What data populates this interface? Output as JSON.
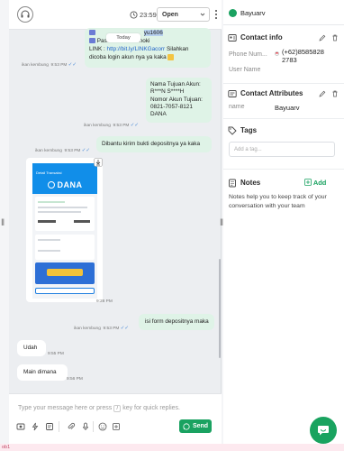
{
  "header": {
    "time": "23:59",
    "status": "Open"
  },
  "messages": {
    "date_separator": "Today",
    "msg1": {
      "line1": "yu1606",
      "line2": "Password : kokohoki",
      "line3_prefix": "LINK : ",
      "line3_link": "http://bit.ly/LINKGacorr",
      "line3_suffix": " Silahkan",
      "line4": "dicoba login akun nya ya kaka",
      "sender": "ikan kembung",
      "time": "9:53 PM"
    },
    "msg2": {
      "line1": "Nama Tujuan Akun:",
      "line2": "R***N S****H",
      "line3": "Nomor Akun Tujuan:",
      "line4": "0821-7057-8121",
      "line5": "DANA",
      "sender": "ikan kembung",
      "time": "9:53 PM"
    },
    "msg3": {
      "text": "Dibantu kirim bukti depositnya ya kaka",
      "sender": "ikan kembung",
      "time": "9:53 PM"
    },
    "image_msg": {
      "time": "9:28 PM",
      "receipt_brand": "DANA",
      "receipt_title": "Detail Transaksi"
    },
    "msg4": {
      "text": "isi form depositnya maka",
      "sender": "ikan kembung",
      "time": "9:53 PM"
    },
    "msg5": {
      "text": "Udah",
      "time": "9:55 PM"
    },
    "msg6": {
      "text": "Main dimana",
      "time": "9:56 PM"
    }
  },
  "composer": {
    "placeholder_pre": "Type your message here or press",
    "shortcut": "/",
    "placeholder_post": "key for quick replies.",
    "send_label": "Send"
  },
  "panel": {
    "username": "Bayuarv",
    "contact_info": {
      "title": "Contact info",
      "phone_label": "Phone Num...",
      "phone_value_line1": "(+62)8585828",
      "phone_value_line2": "2783",
      "user_name_label": "User Name"
    },
    "attributes": {
      "title": "Contact Attributes",
      "key": "name",
      "value": "Bayuarv"
    },
    "tags": {
      "title": "Tags",
      "placeholder": "Add a tag..."
    },
    "notes": {
      "title": "Notes",
      "add_label": "Add",
      "hint": "Notes help you to keep track of your conversation with your team"
    }
  },
  "footer": {
    "label": "ob1"
  },
  "colors": {
    "accent_green": "#1aa261",
    "outgoing_bubble": "#dff3e7",
    "incoming_bubble": "#ffffff",
    "chat_background": "#eceef1",
    "link_blue": "#1f62c8",
    "tick_blue": "#4b8ad6"
  },
  "icons": [
    "headset-avatar-icon",
    "clock-icon",
    "chevron-down-icon",
    "more-vertical-icon",
    "download-icon",
    "double-check-icon",
    "emoji-icon",
    "bolt-icon",
    "paperclip-icon",
    "microphone-icon",
    "whatsapp-icon",
    "contact-card-icon",
    "pencil-icon",
    "trash-icon",
    "tag-icon",
    "notes-icon",
    "plus-icon",
    "chat-fab-icon"
  ]
}
